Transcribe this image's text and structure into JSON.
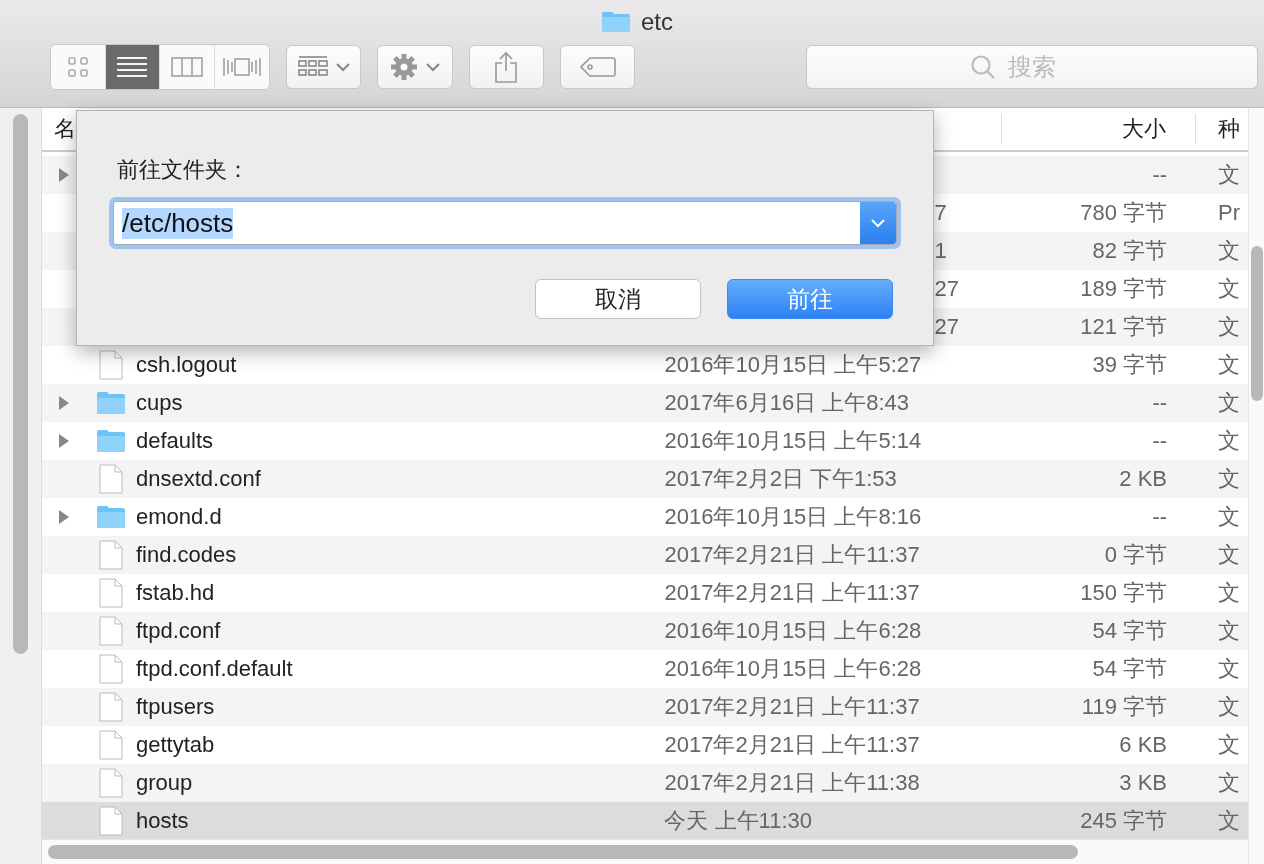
{
  "window": {
    "title": "etc"
  },
  "toolbar": {
    "view_buttons": [
      {
        "kind": "icons",
        "selected": false
      },
      {
        "kind": "list",
        "selected": true
      },
      {
        "kind": "columns",
        "selected": false
      },
      {
        "kind": "coverflow",
        "selected": false
      }
    ],
    "search": {
      "placeholder": "搜索"
    }
  },
  "table": {
    "columns": [
      "名",
      "大小",
      "种"
    ],
    "rows": [
      {
        "kind": "folder",
        "size": "--",
        "type": "文",
        "selected": false
      },
      {
        "kind": "file",
        "date_tail": "7",
        "size": "780 字节",
        "type": "Pr",
        "selected": false
      },
      {
        "kind": "file",
        "date_tail": "1",
        "size": "82 字节",
        "type": "文",
        "selected": false
      },
      {
        "kind": "file",
        "date_tail": "27",
        "size": "189 字节",
        "type": "文",
        "selected": false
      },
      {
        "kind": "file",
        "date_tail": "27",
        "size": "121 字节",
        "type": "文",
        "selected": false
      },
      {
        "kind": "file",
        "name": "csh.logout",
        "date": "2016年10月15日 上午5:27",
        "size": "39 字节",
        "type": "文",
        "selected": false
      },
      {
        "kind": "folder",
        "name": "cups",
        "date": "2017年6月16日 上午8:43",
        "size": "--",
        "type": "文",
        "selected": false
      },
      {
        "kind": "folder",
        "name": "defaults",
        "date": "2016年10月15日 上午5:14",
        "size": "--",
        "type": "文",
        "selected": false
      },
      {
        "kind": "file",
        "name": "dnsextd.conf",
        "date": "2017年2月2日 下午1:53",
        "size": "2 KB",
        "type": "文",
        "selected": false
      },
      {
        "kind": "folder",
        "name": "emond.d",
        "date": "2016年10月15日 上午8:16",
        "size": "--",
        "type": "文",
        "selected": false
      },
      {
        "kind": "file",
        "name": "find.codes",
        "date": "2017年2月21日 上午11:37",
        "size": "0 字节",
        "type": "文",
        "selected": false
      },
      {
        "kind": "file",
        "name": "fstab.hd",
        "date": "2017年2月21日 上午11:37",
        "size": "150 字节",
        "type": "文",
        "selected": false
      },
      {
        "kind": "file",
        "name": "ftpd.conf",
        "date": "2016年10月15日 上午6:28",
        "size": "54 字节",
        "type": "文",
        "selected": false
      },
      {
        "kind": "file",
        "name": "ftpd.conf.default",
        "date": "2016年10月15日 上午6:28",
        "size": "54 字节",
        "type": "文",
        "selected": false
      },
      {
        "kind": "file",
        "name": "ftpusers",
        "date": "2017年2月21日 上午11:37",
        "size": "119 字节",
        "type": "文",
        "selected": false
      },
      {
        "kind": "file",
        "name": "gettytab",
        "date": "2017年2月21日 上午11:37",
        "size": "6 KB",
        "type": "文",
        "selected": false
      },
      {
        "kind": "file",
        "name": "group",
        "date": "2017年2月21日 上午11:38",
        "size": "3 KB",
        "type": "文",
        "selected": false
      },
      {
        "kind": "file",
        "name": "hosts",
        "date": "今天 上午11:30",
        "size": "245 字节",
        "type": "文",
        "selected": true
      }
    ]
  },
  "dialog": {
    "label": "前往文件夹：",
    "value": "/etc/hosts",
    "buttons": [
      {
        "label": "取消",
        "kind": "secondary"
      },
      {
        "label": "前往",
        "kind": "primary"
      }
    ]
  }
}
